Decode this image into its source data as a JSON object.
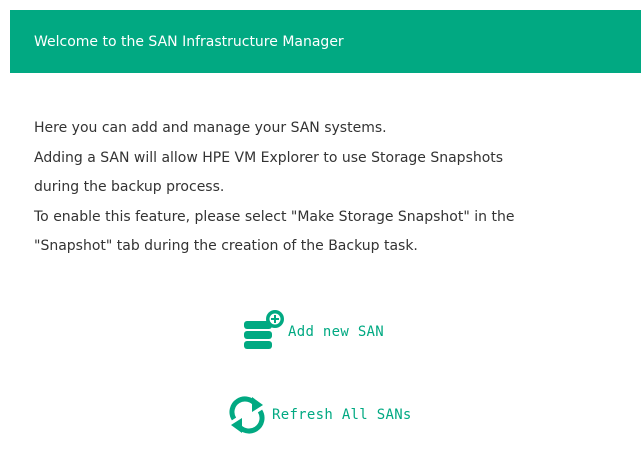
{
  "header": {
    "title": "Welcome to the SAN Infrastructure Manager"
  },
  "description": {
    "lines": [
      "Here you can add and manage your SAN systems.",
      "Adding a SAN will allow HPE VM Explorer to use Storage Snapshots",
      "during the backup process.",
      "To enable this feature, please select \"Make Storage Snapshot\" in the",
      "\"Snapshot\" tab during the creation of the Backup task."
    ]
  },
  "actions": {
    "add_san": {
      "label": "Add new SAN",
      "icon": "storage-add-icon"
    },
    "refresh": {
      "label": "Refresh All SANs",
      "icon": "refresh-icon"
    }
  },
  "colors": {
    "accent": "#01a982",
    "text": "#333333",
    "header_text": "#ffffff"
  }
}
